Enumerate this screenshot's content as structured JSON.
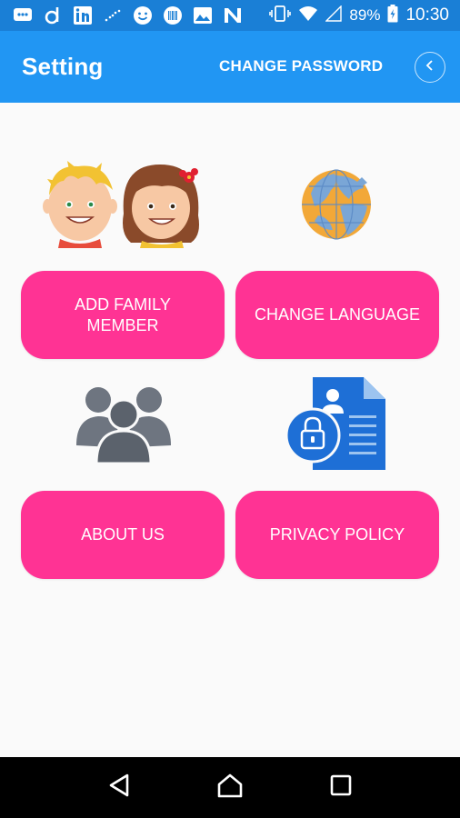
{
  "status_bar": {
    "battery": "89%",
    "time": "10:30",
    "icons": [
      "messages-icon",
      "d-app-icon",
      "linkedin-icon",
      "dotted-line-icon",
      "smiley-icon",
      "barcode-icon",
      "image-icon",
      "n-app-icon"
    ]
  },
  "app_bar": {
    "title": "Setting",
    "change_password": "CHANGE PASSWORD"
  },
  "buttons": {
    "add_family_member": "ADD FAMILY MEMBER",
    "change_language": "CHANGE LANGUAGE",
    "about_us": "ABOUT US",
    "privacy_policy": "PRIVACY POLICY"
  },
  "colors": {
    "status_bar": "#1a7fd6",
    "app_bar": "#2196f3",
    "button_pink": "#ff3394",
    "background": "#fafafa",
    "nav_bar": "#000000"
  }
}
